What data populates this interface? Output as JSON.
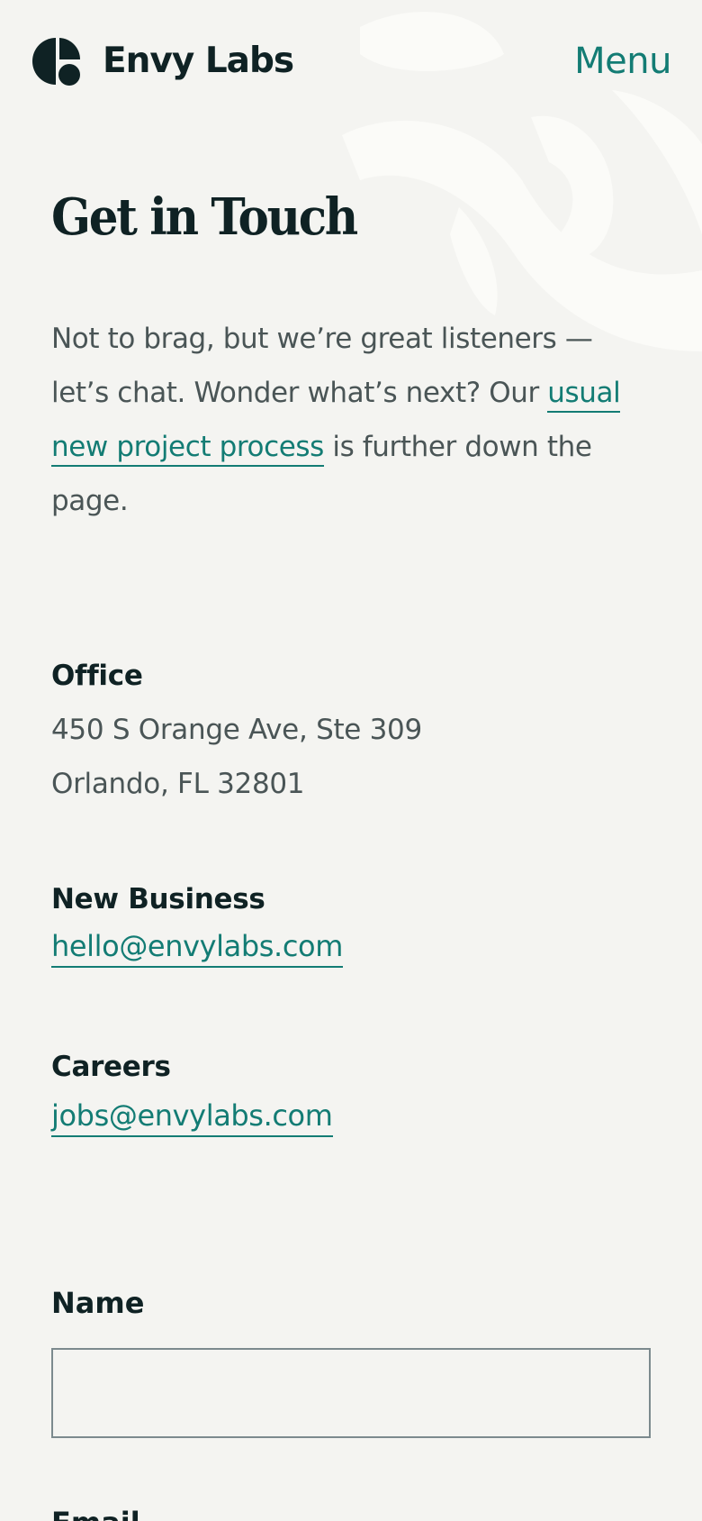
{
  "header": {
    "brand_name": "Envy Labs",
    "menu_label": "Menu",
    "logo_icon": "envy-labs-logo-icon"
  },
  "hero": {
    "title": "Get in Touch",
    "intro_before": "Not to brag, but we’re great listeners — let’s chat. Wonder what’s next? Our ",
    "intro_link": "usual new project process",
    "intro_after": " is further down the page."
  },
  "contact": {
    "office": {
      "heading": "Office",
      "address_line1": "450 S Orange Ave, Ste 309",
      "address_line2": "Orlando, FL 32801"
    },
    "new_business": {
      "heading": "New Business",
      "email": "hello@envylabs.com"
    },
    "careers": {
      "heading": "Careers",
      "email": "jobs@envylabs.com"
    }
  },
  "form": {
    "name_label": "Name",
    "name_value": "",
    "email_label": "Email"
  },
  "colors": {
    "background": "#f4f4f1",
    "text_dark": "#0f2224",
    "text_body": "#4a5556",
    "accent": "#137c74"
  }
}
